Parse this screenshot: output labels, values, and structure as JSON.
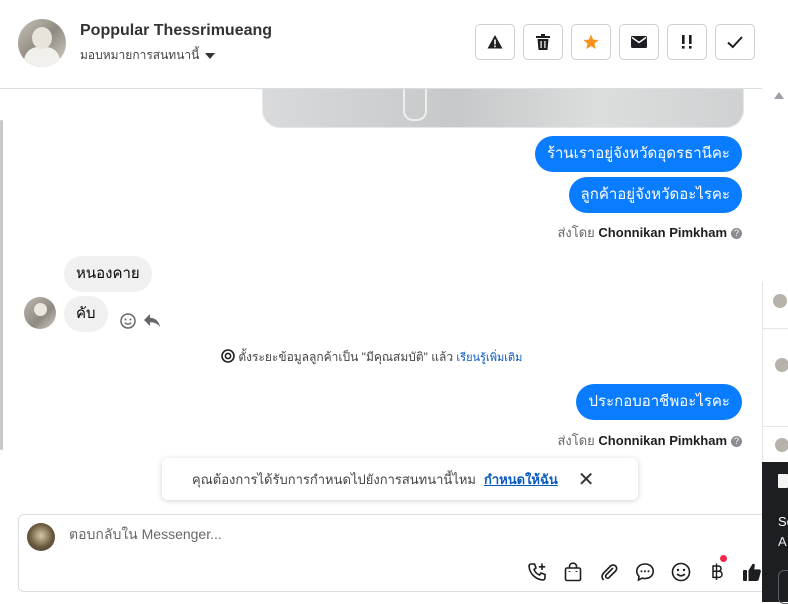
{
  "header": {
    "contact_name": "Poppular Thessrimueang",
    "assign_label": "มอบหมายการสนทนานี้",
    "actions": [
      {
        "name": "report-button",
        "icon": "warning-icon"
      },
      {
        "name": "delete-button",
        "icon": "trash-icon"
      },
      {
        "name": "star-button",
        "icon": "star-icon",
        "color": "#f7931e"
      },
      {
        "name": "email-button",
        "icon": "envelope-icon"
      },
      {
        "name": "priority-button",
        "icon": "exclamation-icon"
      },
      {
        "name": "done-button",
        "icon": "check-icon"
      }
    ]
  },
  "messages": {
    "out1": "ร้านเราอยู่จังหวัดอุดรธานีคะ",
    "out2": "ลูกค้าอยู่จังหวัดอะไรคะ",
    "sent_by_prefix": "ส่งโดย",
    "sent_by_name": "Chonnikan Pimkham",
    "in1": "หนองคาย",
    "in2": "คับ",
    "notice_text": "ตั้งระยะข้อมูลลูกค้าเป็น \"มีคุณสมบัติ\" แล้ว",
    "notice_link": "เรียนรู้เพิ่มเติม",
    "out3": "ประกอบอาชีพอะไรคะ",
    "sent_by_prefix2": "ส่งโดย",
    "sent_by_name2": "Chonnikan Pimkham"
  },
  "toast": {
    "text": "คุณต้องการได้รับการกำหนดไปยังการสนทนานี้ไหม",
    "link": "กำหนดให้ฉัน",
    "close": "✕"
  },
  "composer": {
    "placeholder": "ตอบกลับใน Messenger...",
    "icons": [
      "phone-plus-icon",
      "shopping-bag-icon",
      "paperclip-icon",
      "chat-bubble-icon",
      "emoji-icon",
      "baht-icon",
      "like-icon"
    ]
  },
  "side_panel": {
    "text1": "Sc",
    "text2": "A"
  },
  "colors": {
    "accent": "#0a7cff",
    "star": "#f7931e",
    "badge": "#f02849"
  }
}
